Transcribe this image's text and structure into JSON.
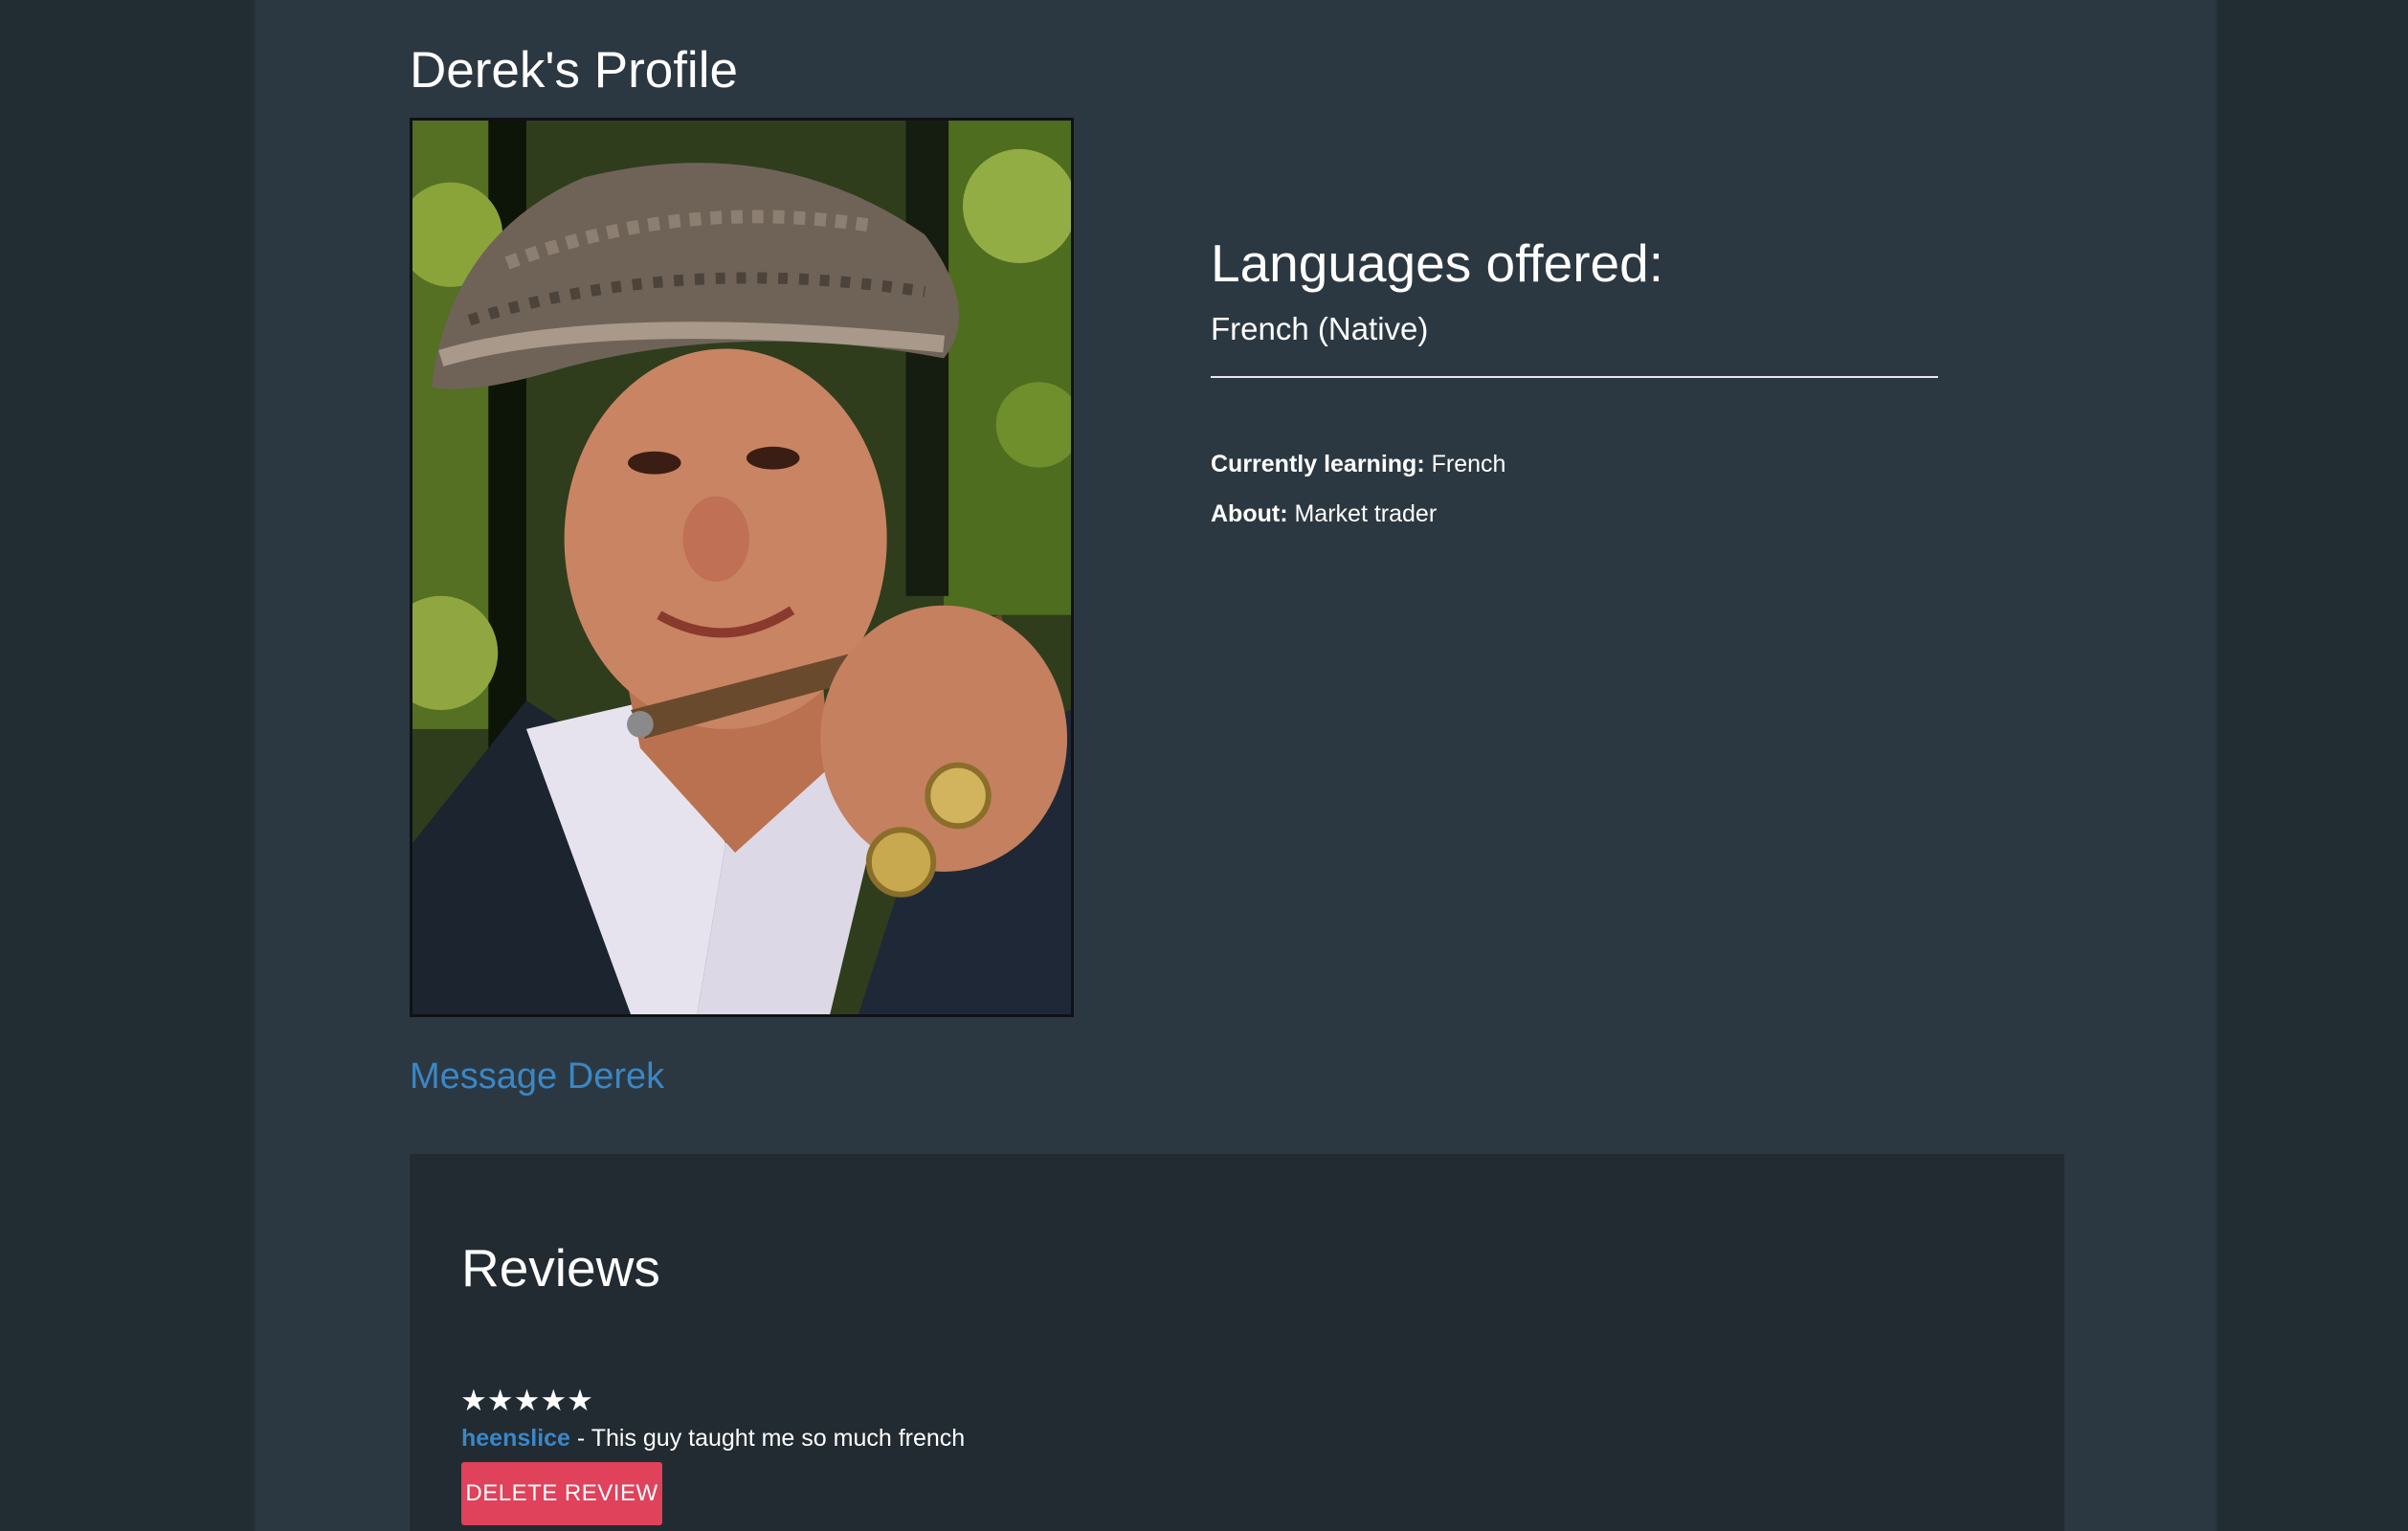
{
  "profile": {
    "title": "Derek's Profile",
    "photo_icon": "profile-photo"
  },
  "languages": {
    "heading": "Languages offered:",
    "items": [
      "French (Native)"
    ]
  },
  "info": {
    "learning_label": "Currently learning:",
    "learning_value": "French",
    "about_label": "About:",
    "about_value": "Market trader"
  },
  "actions": {
    "message_label": "Message Derek"
  },
  "reviews": {
    "heading": "Reviews",
    "items": [
      {
        "stars": "★★★★★",
        "rating": 5,
        "author": "heenslice",
        "separator": " - ",
        "text": "This guy taught me so much french",
        "delete_label": "DELETE REVIEW"
      }
    ]
  },
  "colors": {
    "page_background": "#222c33",
    "panel_background": "#2c3841",
    "reviews_background": "#222b32",
    "link": "#3a87c7",
    "danger": "#e0415b"
  }
}
